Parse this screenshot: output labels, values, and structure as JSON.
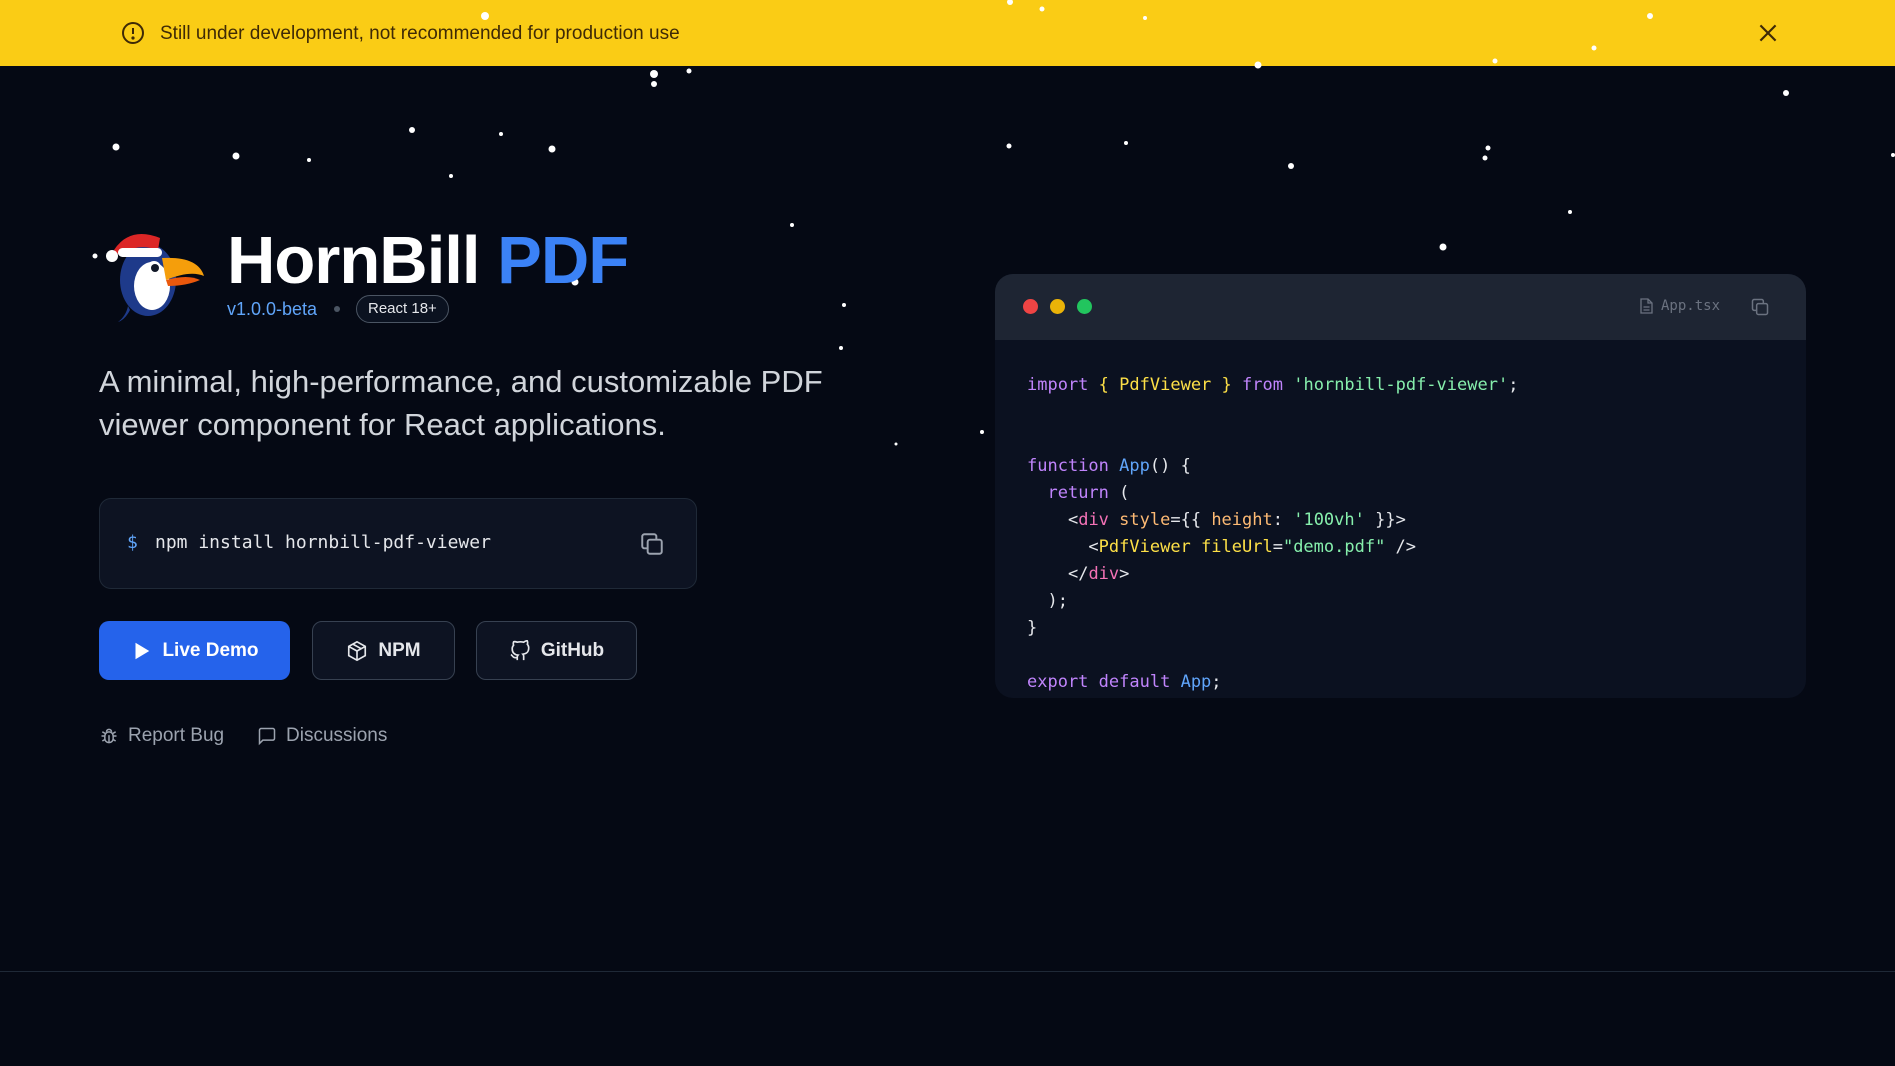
{
  "banner": {
    "icon": "alert-circle-icon",
    "text": "Still under development, not recommended for production use",
    "close_icon": "close-icon",
    "color": "#facc15"
  },
  "hero": {
    "brand_main": "HornBill",
    "brand_accent": "PDF",
    "version": "v1.0.0-beta",
    "react_badge": "React 18+",
    "tagline": "A minimal, high-performance, and customizable PDF viewer component for React applications.",
    "install_prompt": "$",
    "install_command": "npm install hornbill-pdf-viewer",
    "accent_color": "#3b82f6"
  },
  "buttons": {
    "live_demo": "Live Demo",
    "npm": "NPM",
    "github": "GitHub"
  },
  "links": {
    "report_bug": "Report Bug",
    "discussions": "Discussions"
  },
  "editor": {
    "filename": "App.tsx",
    "lines": {
      "l1_import": "import",
      "l1_open": "{",
      "l1_name": "PdfViewer",
      "l1_close": "}",
      "l1_from": "from",
      "l1_module": "'hornbill-pdf-viewer'",
      "l1_end": ";",
      "l3_function": "function",
      "l3_name": "App",
      "l3_rest": "() {",
      "l4_return": "return",
      "l4_rest": " (",
      "l5_lt": "<",
      "l5_tag": "div",
      "l5_attr": "style",
      "l5_eq": "={{ ",
      "l5_key": "height",
      "l5_colon": ": ",
      "l5_value": "'100vh'",
      "l5_end": " }}>",
      "l6_lt": "<",
      "l6_tag": "PdfViewer",
      "l6_attr": "fileUrl",
      "l6_eq": "=",
      "l6_value": "\"demo.pdf\"",
      "l6_end": " />",
      "l7_lt": "</",
      "l7_tag": "div",
      "l7_end": ">",
      "l8": ");",
      "l9": "}",
      "l11_export": "export",
      "l11_default": "default",
      "l11_name": "App",
      "l11_end": ";"
    }
  }
}
